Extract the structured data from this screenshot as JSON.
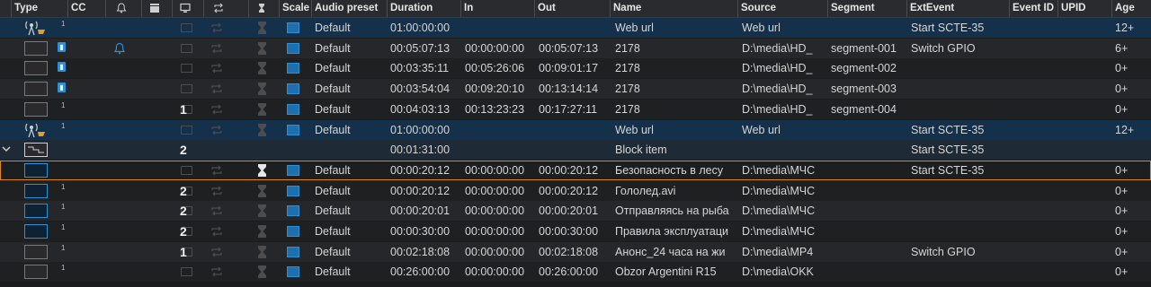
{
  "headers": {
    "type": "Type",
    "cc": "CC",
    "scale": "Scale",
    "audio_preset": "Audio preset",
    "duration": "Duration",
    "in": "In",
    "out": "Out",
    "name": "Name",
    "source": "Source",
    "segment": "Segment",
    "ext_event": "ExtEvent",
    "event_id": "Event ID",
    "upid": "UPID",
    "age": "Age"
  },
  "rows": [
    {
      "style": "sel",
      "thumb": "url",
      "sup": "1",
      "cc": false,
      "bell": false,
      "count": "",
      "audio": "Default",
      "duration": "01:00:00:00",
      "in": "",
      "out": "",
      "name": "Web url",
      "source": "Web url",
      "segment": "",
      "ext_event": "Start SCTE-35",
      "age": "12+"
    },
    {
      "style": "light",
      "thumb": "gray",
      "sup": "",
      "cc": true,
      "bell": true,
      "count": "",
      "audio": "Default",
      "duration": "00:05:07:13",
      "in": "00:00:00:00",
      "out": "00:05:07:13",
      "name": "2178",
      "source": "D:\\media\\HD_",
      "segment": "segment-001",
      "ext_event": "Switch GPIO",
      "age": "6+"
    },
    {
      "style": "dark",
      "thumb": "gray",
      "sup": "",
      "cc": true,
      "bell": false,
      "count": "",
      "audio": "Default",
      "duration": "00:03:35:11",
      "in": "00:05:26:06",
      "out": "00:09:01:17",
      "name": "2178",
      "source": "D:\\media\\HD_",
      "segment": "segment-002",
      "ext_event": "",
      "age": "0+"
    },
    {
      "style": "light",
      "thumb": "gray",
      "sup": "",
      "cc": true,
      "bell": false,
      "count": "",
      "audio": "Default",
      "duration": "00:03:54:04",
      "in": "00:09:20:10",
      "out": "00:13:14:14",
      "name": "2178",
      "source": "D:\\media\\HD_",
      "segment": "segment-003",
      "ext_event": "",
      "age": "0+"
    },
    {
      "style": "dark",
      "thumb": "gray",
      "sup": "1",
      "cc": false,
      "bell": false,
      "count": "1",
      "audio": "Default",
      "duration": "00:04:03:13",
      "in": "00:13:23:23",
      "out": "00:17:27:11",
      "name": "2178",
      "source": "D:\\media\\HD_",
      "segment": "segment-004",
      "ext_event": "",
      "age": "0+"
    },
    {
      "style": "sel",
      "thumb": "url",
      "sup": "1",
      "cc": false,
      "bell": false,
      "count": "",
      "audio": "Default",
      "duration": "01:00:00:00",
      "in": "",
      "out": "",
      "name": "Web url",
      "source": "Web url",
      "segment": "",
      "ext_event": "Start SCTE-35",
      "age": "12+"
    },
    {
      "style": "block",
      "thumb": "block",
      "sup": "",
      "cc": false,
      "bell": false,
      "count": "2",
      "audio": "",
      "duration": "00:01:31:00",
      "in": "",
      "out": "",
      "name": "Block item",
      "source": "",
      "segment": "",
      "ext_event": "Start SCTE-35",
      "age": ""
    },
    {
      "style": "cur",
      "thumb": "blue",
      "sup": "",
      "cc": false,
      "bell": false,
      "count": "",
      "audio": "Default",
      "duration": "00:00:20:12",
      "in": "00:00:00:00",
      "out": "00:00:20:12",
      "name": "Безопасность в лесу",
      "source": "D:\\media\\МЧС",
      "segment": "",
      "ext_event": "Start SCTE-35",
      "age": "0+"
    },
    {
      "style": "dark",
      "thumb": "blue",
      "sup": "1",
      "cc": false,
      "bell": false,
      "count": "2",
      "audio": "Default",
      "duration": "00:00:20:12",
      "in": "00:00:00:00",
      "out": "00:00:20:12",
      "name": "Гололед.avi",
      "source": "D:\\media\\МЧС",
      "segment": "",
      "ext_event": "",
      "age": "0+"
    },
    {
      "style": "light",
      "thumb": "blue",
      "sup": "1",
      "cc": false,
      "bell": false,
      "count": "2",
      "audio": "Default",
      "duration": "00:00:20:01",
      "in": "00:00:00:00",
      "out": "00:00:20:01",
      "name": "Отправляясь на рыба",
      "source": "D:\\media\\МЧС",
      "segment": "",
      "ext_event": "",
      "age": "0+"
    },
    {
      "style": "dark",
      "thumb": "blue",
      "sup": "1",
      "cc": false,
      "bell": false,
      "count": "2",
      "audio": "Default",
      "duration": "00:00:30:00",
      "in": "00:00:00:00",
      "out": "00:00:30:00",
      "name": "Правила эксплуатаци",
      "source": "D:\\media\\МЧС",
      "segment": "",
      "ext_event": "",
      "age": "0+"
    },
    {
      "style": "light",
      "thumb": "gray",
      "sup": "1",
      "cc": false,
      "bell": false,
      "count": "1",
      "audio": "Default",
      "duration": "00:02:18:08",
      "in": "00:00:00:00",
      "out": "00:02:18:08",
      "name": "Анонс_24 часа на жи",
      "source": "D:\\media\\MP4",
      "segment": "",
      "ext_event": "Switch GPIO",
      "age": "0+"
    },
    {
      "style": "dark",
      "thumb": "gray",
      "sup": "1",
      "cc": false,
      "bell": false,
      "count": "",
      "audio": "Default",
      "duration": "00:26:00:00",
      "in": "00:00:00:00",
      "out": "00:26:00:00",
      "name": "Obzor Argentini R15",
      "source": "D:\\media\\OKK",
      "segment": "",
      "ext_event": "",
      "age": "0+"
    }
  ],
  "colors": {
    "accent_blue": "#2d8fd6",
    "selected_row": "#14304a",
    "current_outline": "#e08a17"
  },
  "icons": {
    "header": [
      "bell-icon",
      "clapper-icon",
      "monitor-icon",
      "loop-icon",
      "hourglass-icon"
    ],
    "row": [
      "antenna-icon",
      "thumbnail-icon",
      "monitor-icon",
      "loop-icon",
      "hourglass-icon",
      "scale-icon",
      "chevron-down-icon"
    ]
  }
}
